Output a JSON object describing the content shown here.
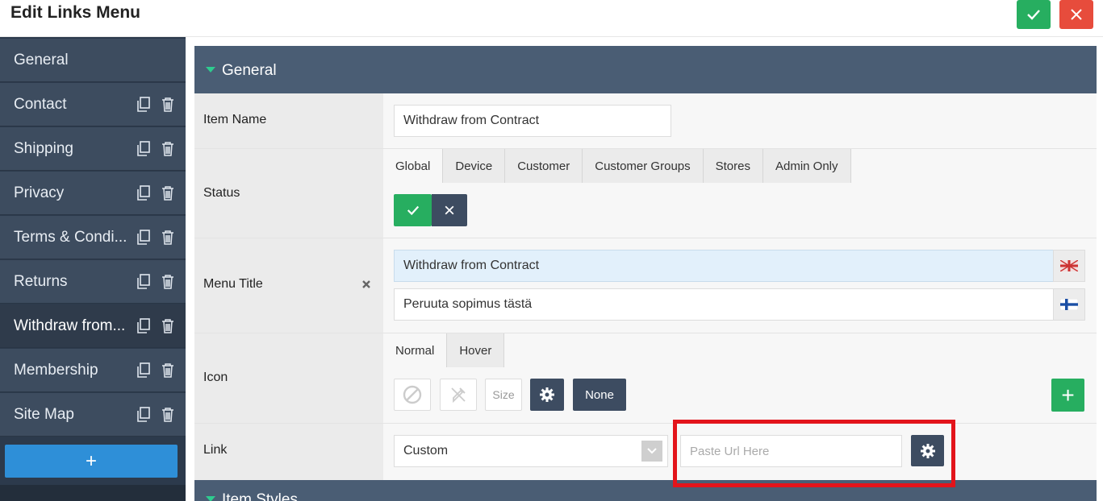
{
  "header": {
    "title": "Edit Links Menu",
    "confirm_icon": "check-icon",
    "close_icon": "close-icon"
  },
  "sidebar": {
    "items": [
      {
        "label": "General"
      },
      {
        "label": "Contact"
      },
      {
        "label": "Shipping"
      },
      {
        "label": "Privacy"
      },
      {
        "label": "Terms & Condi..."
      },
      {
        "label": "Returns"
      },
      {
        "label": "Withdraw from..."
      },
      {
        "label": "Membership"
      },
      {
        "label": "Site Map"
      }
    ],
    "active_index": 6,
    "add_label": "+"
  },
  "panel": {
    "title": "General",
    "item_name": {
      "label": "Item Name",
      "value": "Withdraw from Contract"
    },
    "status": {
      "label": "Status",
      "tabs": [
        "Global",
        "Device",
        "Customer",
        "Customer Groups",
        "Stores",
        "Admin Only"
      ],
      "active_tab": "Global"
    },
    "menu_title": {
      "label": "Menu Title",
      "value_en": "Withdraw from Contract",
      "value_fi": "Peruuta sopimus tästä"
    },
    "icon": {
      "label": "Icon",
      "tabs": [
        "Normal",
        "Hover"
      ],
      "size_label": "Size",
      "none_label": "None",
      "add_label": "+"
    },
    "link": {
      "label": "Link",
      "type_value": "Custom",
      "url_placeholder": "Paste Url Here"
    }
  },
  "next_panel": {
    "title": "Item Styles"
  },
  "colors": {
    "accent_green": "#27ae60",
    "accent_red": "#e74c3c",
    "sidebar_bg": "#3d4c5f",
    "panel_header": "#4a5d74",
    "highlight_box": "#e3141b"
  }
}
